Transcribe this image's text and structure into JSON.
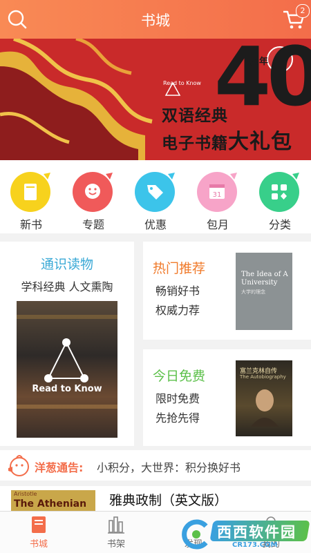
{
  "header": {
    "title": "书城",
    "cart_badge": "2"
  },
  "banner": {
    "brand": "Read to Know",
    "years": "40",
    "years_suffix": "周年",
    "line1": "双语经典",
    "line2_a": "电子书籍",
    "line2_b": "大礼包"
  },
  "categories": [
    {
      "label": "新书",
      "icon": "book-icon",
      "color": "#f7d21d"
    },
    {
      "label": "专题",
      "icon": "smile-icon",
      "color": "#f05a5a"
    },
    {
      "label": "优惠",
      "icon": "tag-icon",
      "color": "#3cc4ea"
    },
    {
      "label": "包月",
      "icon": "calendar-icon",
      "color": "#f7a4c8"
    },
    {
      "label": "分类",
      "icon": "grid-icon",
      "color": "#38cf8a"
    }
  ],
  "cards": {
    "general": {
      "title": "通识读物",
      "subtitle": "学科经典 人文熏陶",
      "cover_text": "Read to Know"
    },
    "hot": {
      "title": "热门推荐",
      "line1": "畅销好书",
      "line2": "权威力荐",
      "cover_title": "The Idea of A University",
      "cover_cn": "大学的理念"
    },
    "free": {
      "title": "今日免费",
      "line1": "限时免费",
      "line2": "先抢先得",
      "cover_cn": "富兰克林自传",
      "cover_title": "The Autobiography"
    }
  },
  "notice": {
    "label": "洋葱通告:",
    "text": "小积分，大世界：积分换好书"
  },
  "book_row": {
    "title": "雅典政制（英文版）",
    "cover_author": "Aristotle",
    "cover_title": "The Athenian"
  },
  "nav": [
    {
      "label": "书城",
      "active": true
    },
    {
      "label": "书架",
      "active": false
    },
    {
      "label": "发现",
      "active": false
    },
    {
      "label": "我的",
      "active": false
    }
  ],
  "watermark": {
    "text": "西西软件园",
    "sub": "CR173.COM"
  },
  "colors": {
    "accent": "#f36d4a",
    "banner_red": "#c92a2a"
  }
}
